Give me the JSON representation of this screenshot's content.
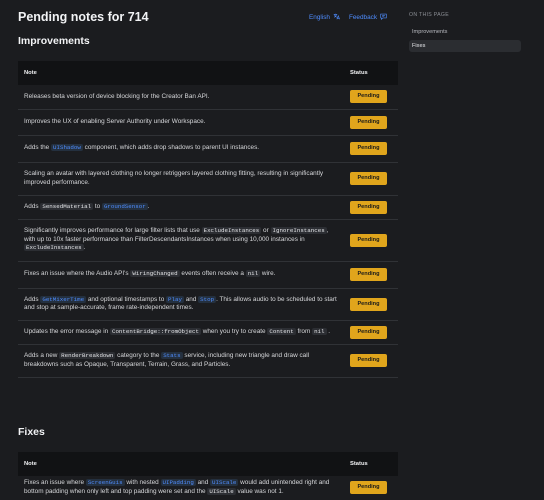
{
  "header": {
    "title": "Pending notes for 714",
    "language_label": "English",
    "feedback_label": "Feedback"
  },
  "toc": {
    "heading": "ON THIS PAGE",
    "items": [
      {
        "label": "Improvements",
        "active": false
      },
      {
        "label": "Fixes",
        "active": true
      }
    ]
  },
  "improvements": {
    "title": "Improvements",
    "col_note": "Note",
    "col_status": "Status",
    "rows": [
      {
        "status": "Pending",
        "parts": [
          {
            "t": "Releases beta version of device blocking for the Creator Ban API."
          }
        ]
      },
      {
        "status": "Pending",
        "parts": [
          {
            "t": "Improves the UX of enabling Server Authority under Workspace."
          }
        ]
      },
      {
        "status": "Pending",
        "parts": [
          {
            "t": "Adds the "
          },
          {
            "c": "UIShadow",
            "link": true
          },
          {
            "t": " component, which adds drop shadows to parent UI instances."
          }
        ]
      },
      {
        "status": "Pending",
        "parts": [
          {
            "t": "Scaling an avatar with layered clothing no longer retriggers layered clothing fitting, resulting in significantly improved performance."
          }
        ]
      },
      {
        "status": "Pending",
        "parts": [
          {
            "t": "Adds "
          },
          {
            "c": "SensedMaterial"
          },
          {
            "t": " to "
          },
          {
            "c": "GroundSensor",
            "link": true
          },
          {
            "t": "."
          }
        ]
      },
      {
        "status": "Pending",
        "parts": [
          {
            "t": "Significantly improves performance for large filter lists that use "
          },
          {
            "c": "ExcludeInstances"
          },
          {
            "t": " or "
          },
          {
            "c": "IgnoreInstances"
          },
          {
            "t": ", with up to 10x faster performance than FilterDescendantsInstances when using 10,000 instances in "
          },
          {
            "c": "ExcludeInstances"
          },
          {
            "t": "."
          }
        ]
      },
      {
        "status": "Pending",
        "parts": [
          {
            "t": "Fixes an issue where the Audio API's "
          },
          {
            "c": "WiringChanged"
          },
          {
            "t": " events often receive a "
          },
          {
            "c": "nil"
          },
          {
            "t": " wire."
          }
        ]
      },
      {
        "status": "Pending",
        "parts": [
          {
            "t": "Adds "
          },
          {
            "c": "GetMixerTime",
            "link": true
          },
          {
            "t": " and optional timestamps to "
          },
          {
            "c": "Play",
            "link": true
          },
          {
            "t": " and "
          },
          {
            "c": "Stop",
            "link": true
          },
          {
            "t": ". This allows audio to be scheduled to start and stop at sample-accurate, frame rate-independent times."
          }
        ]
      },
      {
        "status": "Pending",
        "parts": [
          {
            "t": "Updates the error message in "
          },
          {
            "c": "ContentBridge::fromObject"
          },
          {
            "t": " when you try to create "
          },
          {
            "c": "Content"
          },
          {
            "t": " from "
          },
          {
            "c": "nil"
          },
          {
            "t": " ."
          }
        ]
      },
      {
        "status": "Pending",
        "parts": [
          {
            "t": "Adds a new "
          },
          {
            "c": "RenderBreakdown"
          },
          {
            "t": " category to the "
          },
          {
            "c": "Stats",
            "link": true
          },
          {
            "t": " service, including new triangle and draw call breakdowns such as Opaque, Transparent, Terrain, Grass, and Particles."
          }
        ]
      }
    ]
  },
  "fixes": {
    "title": "Fixes",
    "col_note": "Note",
    "col_status": "Status",
    "rows": [
      {
        "status": "Pending",
        "parts": [
          {
            "t": "Fixes an issue where "
          },
          {
            "c": "ScreenGuis",
            "link": true
          },
          {
            "t": " with nested "
          },
          {
            "c": "UIPadding",
            "link": true
          },
          {
            "t": " and "
          },
          {
            "c": "UIScale",
            "link": true
          },
          {
            "t": " would add unintended right and bottom padding when only left and top padding were set and the "
          },
          {
            "c": "UIScale"
          },
          {
            "t": " value was not 1."
          }
        ]
      }
    ]
  },
  "colors": {
    "accent": "#4f8dff",
    "badge": "#e0a51c",
    "background": "#1b1c1f"
  },
  "icons": {
    "language": "translate-icon",
    "feedback": "feedback-icon"
  }
}
